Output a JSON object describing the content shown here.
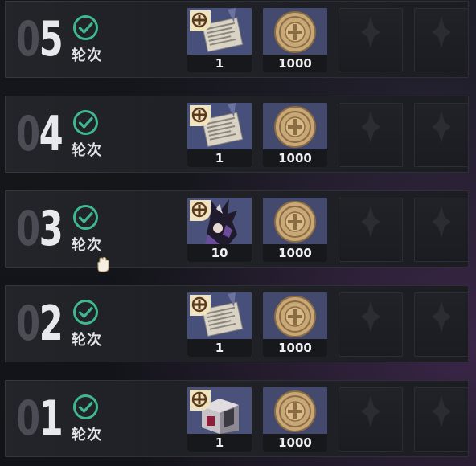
{
  "round_label": "轮次",
  "rows": [
    {
      "round": "05",
      "item_type": "document",
      "item1_count": "1",
      "item2_count": "1000"
    },
    {
      "round": "04",
      "item_type": "document",
      "item1_count": "1",
      "item2_count": "1000"
    },
    {
      "round": "03",
      "item_type": "character",
      "item1_count": "10",
      "item2_count": "1000"
    },
    {
      "round": "02",
      "item_type": "document",
      "item1_count": "1",
      "item2_count": "1000"
    },
    {
      "round": "01",
      "item_type": "crate",
      "item1_count": "1",
      "item2_count": "1000"
    }
  ],
  "colors": {
    "check": "#3fb88e",
    "badge": "#efe3c0",
    "coin": "#c9a877"
  }
}
